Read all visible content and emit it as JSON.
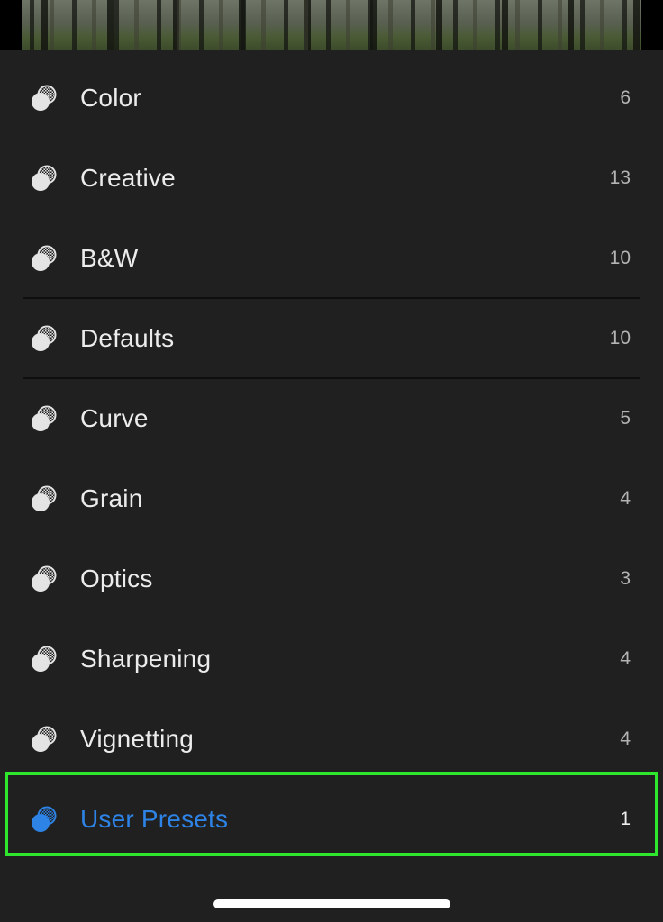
{
  "presets": {
    "items": [
      {
        "label": "Color",
        "count": "6"
      },
      {
        "label": "Creative",
        "count": "13"
      },
      {
        "label": "B&W",
        "count": "10"
      },
      {
        "label": "Defaults",
        "count": "10"
      },
      {
        "label": "Curve",
        "count": "5"
      },
      {
        "label": "Grain",
        "count": "4"
      },
      {
        "label": "Optics",
        "count": "3"
      },
      {
        "label": "Sharpening",
        "count": "4"
      },
      {
        "label": "Vignetting",
        "count": "4"
      },
      {
        "label": "User Presets",
        "count": "1"
      }
    ],
    "selected_index": 9
  },
  "icons": {
    "preset_icon": "preset-circles-icon"
  },
  "colors": {
    "panel_bg": "#202020",
    "text": "#ececec",
    "count_text": "#b4b4b4",
    "selected": "#2d83e6",
    "highlight_box": "#2ee62e"
  }
}
